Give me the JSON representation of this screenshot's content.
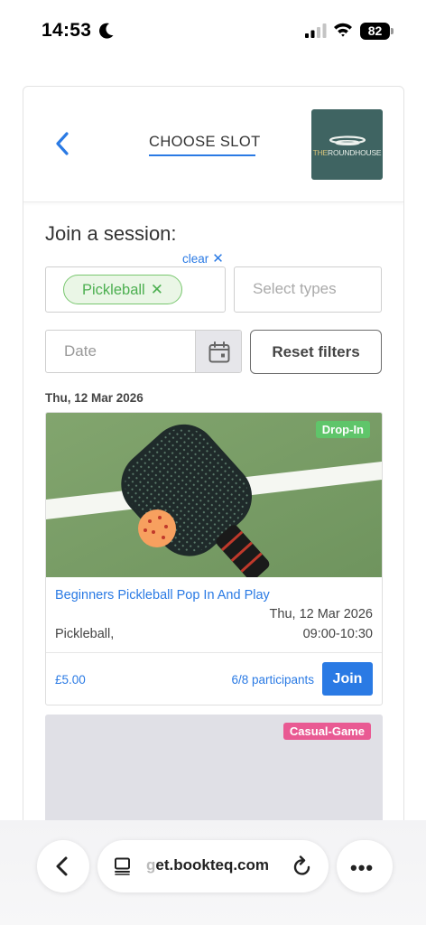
{
  "status_bar": {
    "time": "14:53",
    "battery": "82",
    "icons": [
      "moon-icon",
      "signal-icon",
      "wifi-icon",
      "battery-icon"
    ]
  },
  "header": {
    "title": "CHOOSE SLOT",
    "logo_text_1": "THE",
    "logo_text_2": "ROUNDHOUSE",
    "back_icon": "chevron-left-icon"
  },
  "filters": {
    "heading": "Join a session:",
    "clear_label": "clear",
    "selected_chip": "Pickleball",
    "select_types_placeholder": "Select types",
    "date_placeholder": "Date",
    "reset_label": "Reset filters"
  },
  "day_label": "Thu, 12 Mar 2026",
  "sessions": [
    {
      "badge": "Drop-In",
      "title": "Beginners Pickleball Pop In And Play",
      "date": "Thu, 12 Mar 2026",
      "type": "Pickleball,",
      "time": "09:00-10:30",
      "price": "£5.00",
      "participants": "6/8 participants",
      "join_label": "Join"
    },
    {
      "badge": "Casual-Game"
    }
  ],
  "browser": {
    "url_faded": "g",
    "url": "et.bookteq.com",
    "more": "•••"
  },
  "colors": {
    "accent": "#2a7ae4",
    "chip_green": "#4caf50",
    "dropin_badge": "#5fc56a",
    "casual_badge": "#e95a93",
    "logo_bg": "#3f6462"
  }
}
